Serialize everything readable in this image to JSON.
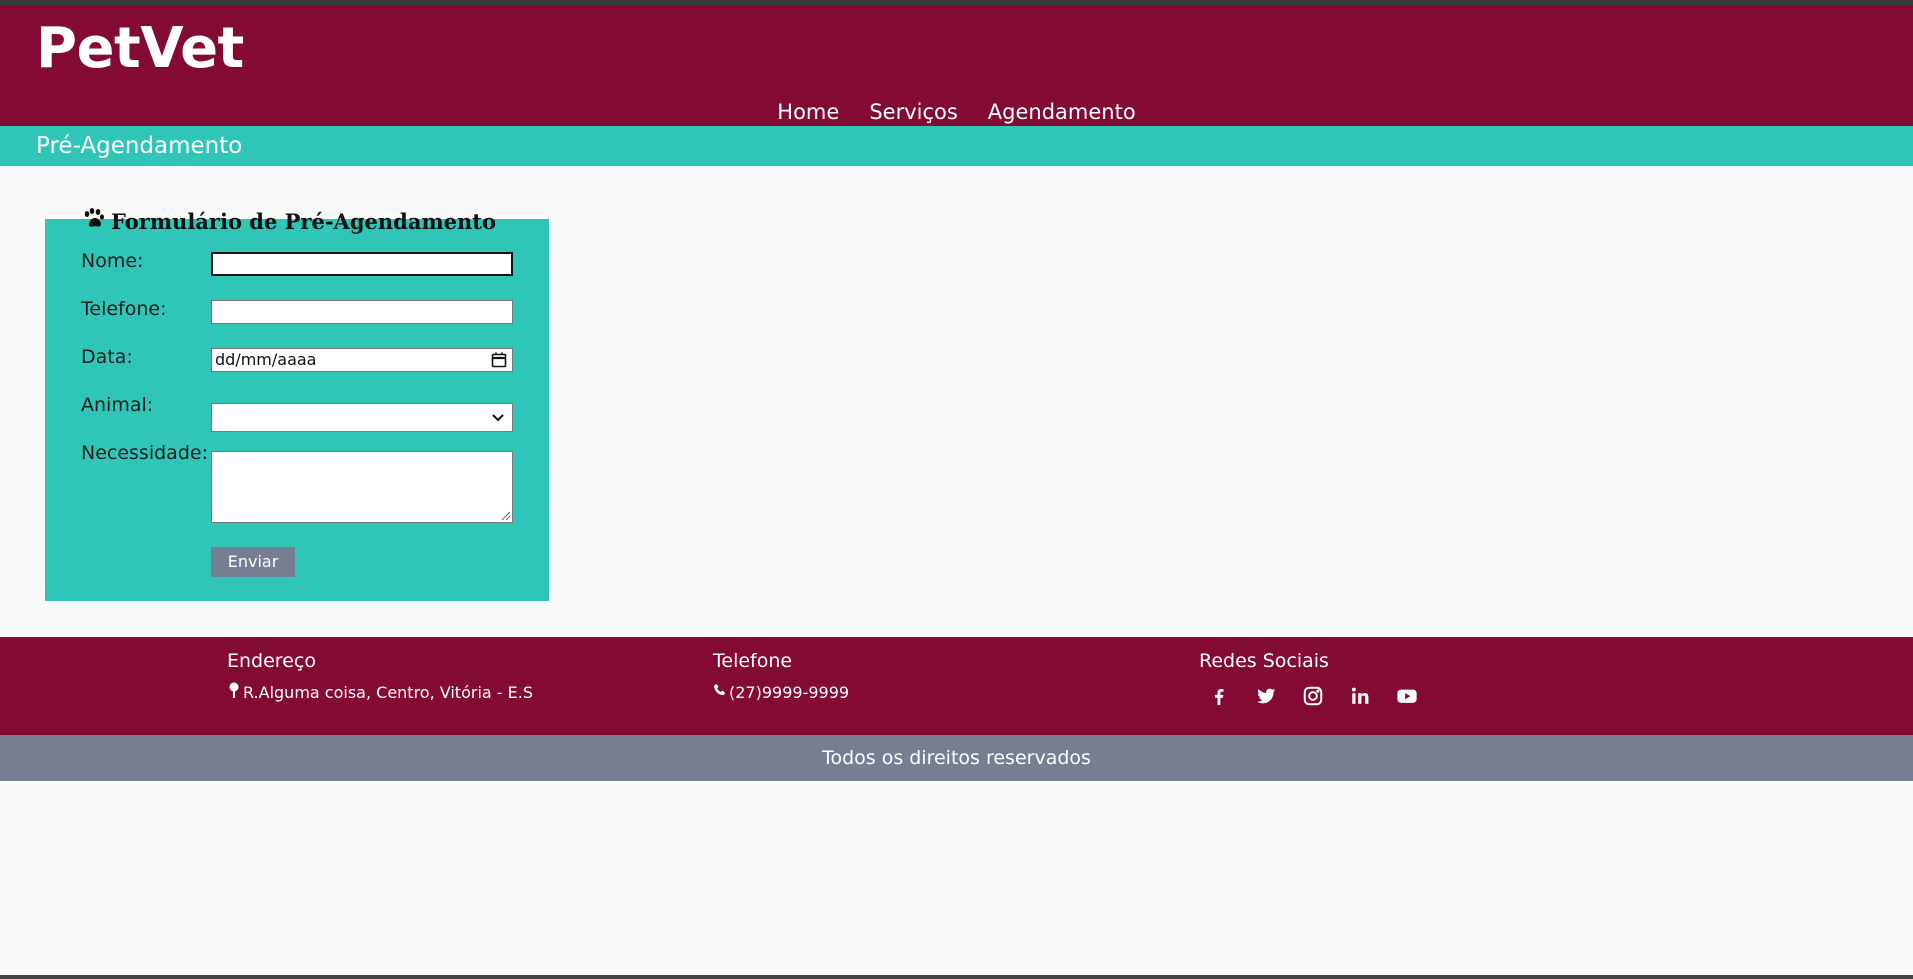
{
  "header": {
    "logo": "PetVet",
    "nav": [
      "Home",
      "Serviços",
      "Agendamento"
    ]
  },
  "subheader": {
    "title": "Pré-Agendamento"
  },
  "form": {
    "title": "Formulário de Pré-Agendamento",
    "title_icon": "paw-icon",
    "labels": {
      "nome": "Nome:",
      "telefone": "Telefone:",
      "data": "Data:",
      "animal": "Animal:",
      "necessidade": "Necessidade:"
    },
    "values": {
      "nome": "",
      "telefone": "",
      "data_placeholder": "dd/mm/aaaa",
      "animal": "",
      "necessidade": ""
    },
    "submit_label": "Enviar"
  },
  "footer": {
    "address": {
      "heading": "Endereço",
      "text": "R.Alguma coisa, Centro, Vitória - E.S",
      "icon": "map-pin-icon"
    },
    "phone": {
      "heading": "Telefone",
      "text": "(27)9999-9999",
      "icon": "phone-icon"
    },
    "social": {
      "heading": "Redes Sociais",
      "icons": [
        "facebook-icon",
        "twitter-icon",
        "instagram-icon",
        "linkedin-icon",
        "youtube-icon"
      ]
    },
    "copyright": "Todos os direitos reservados"
  },
  "colors": {
    "brand": "#830a34",
    "accent": "#2fc6b8",
    "muted": "#767e91",
    "background": "#fafafa"
  }
}
